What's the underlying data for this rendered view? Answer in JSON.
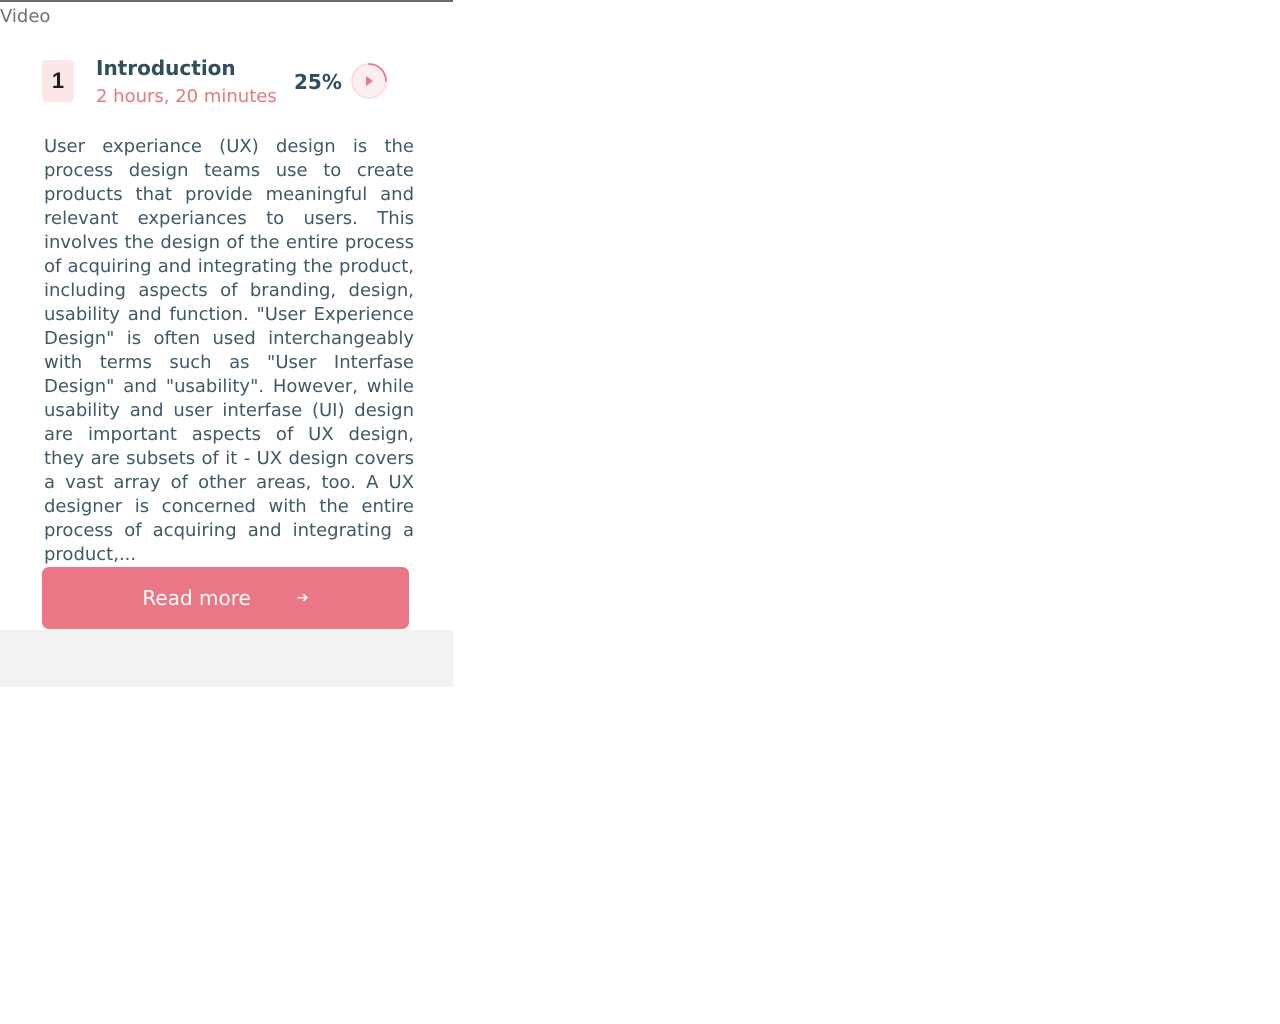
{
  "section": {
    "title": "Video"
  },
  "lesson": {
    "number": "1",
    "title": "Introduction",
    "duration": "2 hours, 20 minutes",
    "progress_label": "25%",
    "progress": 0.25,
    "description": "User experiance (UX) design is the process design teams use to create products that provide meaningful and relevant experiances to users. This involves the design of the entire process of acquiring and integrating the product, including aspects of branding, design, usability and function. \"User Experience Design\" is often used interchangeably with terms such as \"User Interfase Design\" and \"usability\". However, while usability and user interfase (UI) design are important aspects of UX design, they are subsets of it - UX design covers a vast array of other areas, too. A UX designer is concerned with the entire process of acquiring and integrating a product,..."
  },
  "actions": {
    "read_more_label": "Read more",
    "read_more_icon": "arrow-right-icon"
  },
  "colors": {
    "accent": "#ec7784",
    "heading": "#2f4f5c",
    "duration": "#e87680",
    "badge_bg": "#fde6e8",
    "footer_bg": "#f2f2f2"
  }
}
